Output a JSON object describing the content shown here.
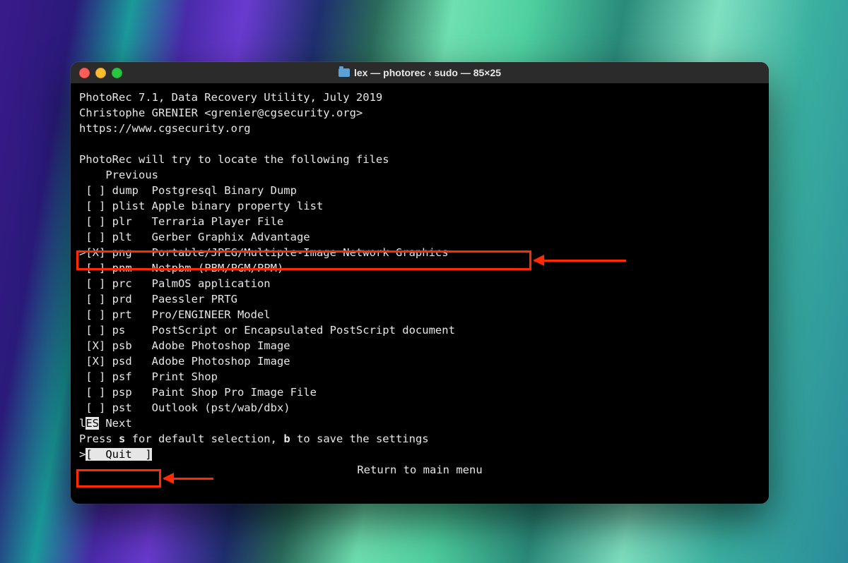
{
  "window": {
    "title": "lex — photorec ‹ sudo — 85×25"
  },
  "header": {
    "line1": "PhotoRec 7.1, Data Recovery Utility, July 2019",
    "line2": "Christophe GRENIER <grenier@cgsecurity.org>",
    "line3": "https://www.cgsecurity.org"
  },
  "intro": "PhotoRec will try to locate the following files",
  "nav_prev": "    Previous",
  "file_types": [
    {
      "cursor": " ",
      "checked": false,
      "ext": "dump",
      "desc": "Postgresql Binary Dump"
    },
    {
      "cursor": " ",
      "checked": false,
      "ext": "plist",
      "desc": "Apple binary property list"
    },
    {
      "cursor": " ",
      "checked": false,
      "ext": "plr",
      "desc": "Terraria Player File"
    },
    {
      "cursor": " ",
      "checked": false,
      "ext": "plt",
      "desc": "Gerber Graphix Advantage"
    },
    {
      "cursor": ">",
      "checked": true,
      "ext": "png",
      "desc": "Portable/JPEG/Multiple-Image Network Graphics"
    },
    {
      "cursor": " ",
      "checked": false,
      "ext": "pnm",
      "desc": "Netpbm (PBM/PGM/PPM)"
    },
    {
      "cursor": " ",
      "checked": false,
      "ext": "prc",
      "desc": "PalmOS application"
    },
    {
      "cursor": " ",
      "checked": false,
      "ext": "prd",
      "desc": "Paessler PRTG"
    },
    {
      "cursor": " ",
      "checked": false,
      "ext": "prt",
      "desc": "Pro/ENGINEER Model"
    },
    {
      "cursor": " ",
      "checked": false,
      "ext": "ps",
      "desc": "PostScript or Encapsulated PostScript document"
    },
    {
      "cursor": " ",
      "checked": true,
      "ext": "psb",
      "desc": "Adobe Photoshop Image"
    },
    {
      "cursor": " ",
      "checked": true,
      "ext": "psd",
      "desc": "Adobe Photoshop Image"
    },
    {
      "cursor": " ",
      "checked": false,
      "ext": "psf",
      "desc": "Print Shop"
    },
    {
      "cursor": " ",
      "checked": false,
      "ext": "psp",
      "desc": "Paint Shop Pro Image File"
    },
    {
      "cursor": " ",
      "checked": false,
      "ext": "pst",
      "desc": "Outlook (pst/wab/dbx)"
    }
  ],
  "nav_next_prefix": "l",
  "nav_next_inv": "ES",
  "nav_next_suffix": " Next",
  "hint": {
    "prefix": "Press ",
    "key1": "s",
    "mid": " for default selection, ",
    "key2": "b",
    "suffix": " to save the settings"
  },
  "menu": {
    "cursor": ">",
    "quit": "[  Quit  ]"
  },
  "footer": "Return to main menu"
}
